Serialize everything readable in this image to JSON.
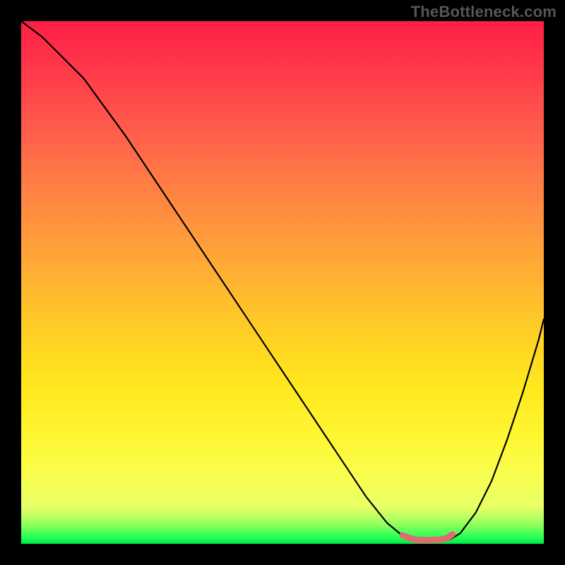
{
  "watermark": "TheBottleneck.com",
  "chart_data": {
    "type": "line",
    "title": "",
    "xlabel": "",
    "ylabel": "",
    "xlim": [
      0,
      100
    ],
    "ylim": [
      0,
      100
    ],
    "series": [
      {
        "name": "left-curve",
        "x": [
          0,
          4,
          12,
          20,
          28,
          36,
          44,
          52,
          60,
          66,
          70,
          73,
          75
        ],
        "y": [
          100,
          97,
          89,
          78,
          66,
          54,
          42,
          30,
          18,
          9,
          4,
          1.5,
          0.8
        ]
      },
      {
        "name": "right-curve",
        "x": [
          82,
          84,
          87,
          90,
          93,
          96,
          99,
          100
        ],
        "y": [
          0.8,
          2,
          6,
          12,
          20,
          29,
          39,
          43
        ]
      }
    ],
    "highlight": {
      "name": "valley-highlight",
      "color": "#e16b6e",
      "x": [
        73,
        74.5,
        76,
        78,
        80,
        81.5,
        82.5
      ],
      "y": [
        1.6,
        1.0,
        0.7,
        0.7,
        0.8,
        1.1,
        1.8
      ]
    },
    "gradient_stops": [
      {
        "pos": 0,
        "color": "#ff1e47"
      },
      {
        "pos": 50,
        "color": "#ffb431"
      },
      {
        "pos": 80,
        "color": "#fff733"
      },
      {
        "pos": 96,
        "color": "#9bff5e"
      },
      {
        "pos": 100,
        "color": "#00e648"
      }
    ]
  }
}
